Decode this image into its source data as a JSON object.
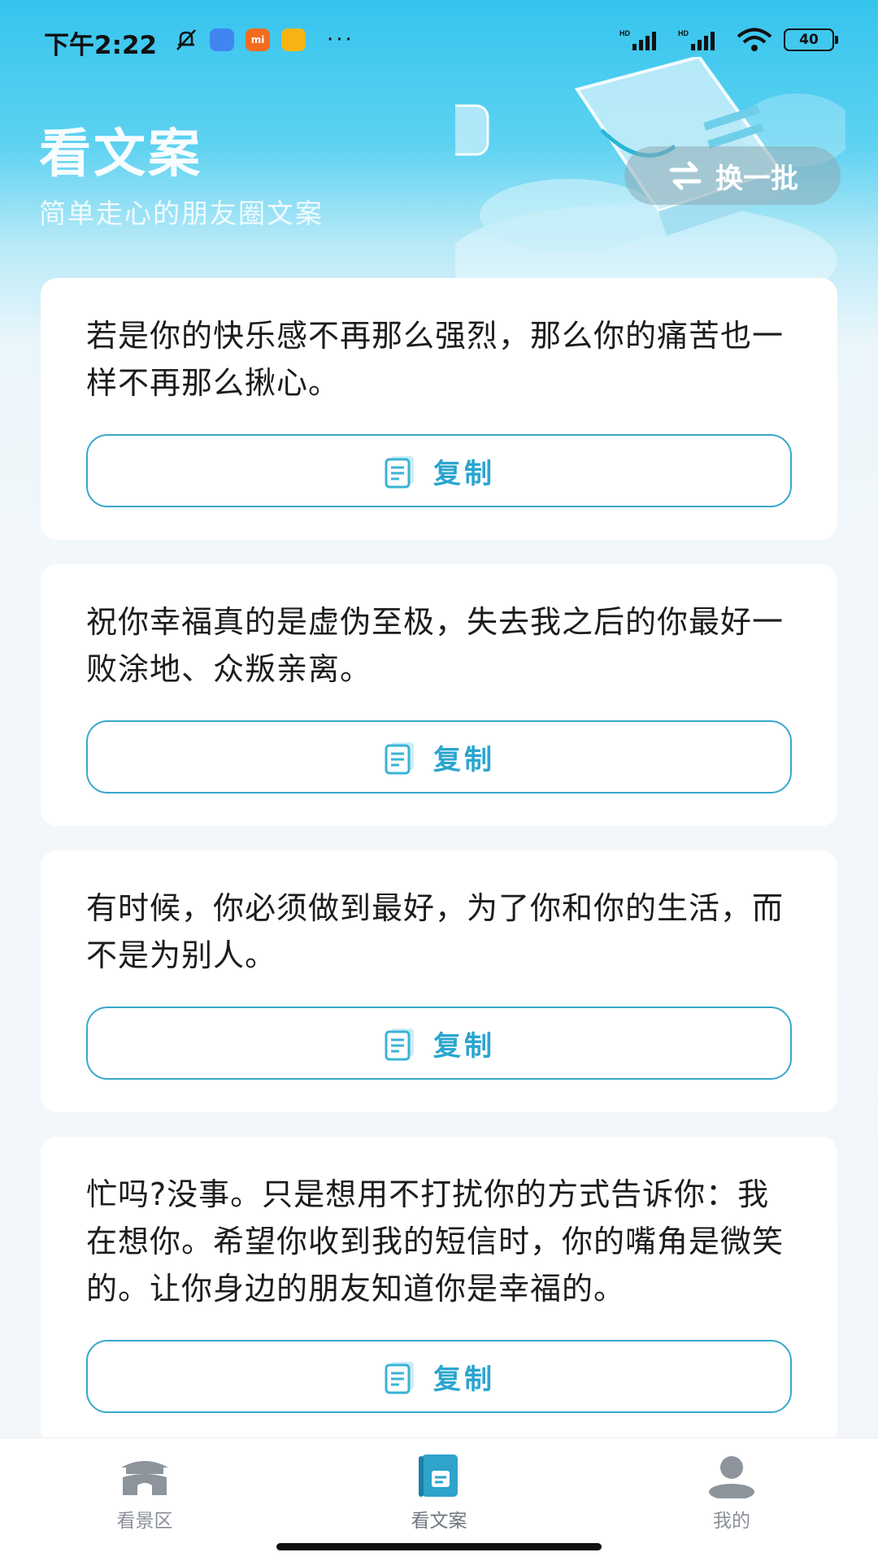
{
  "status_bar": {
    "time": "下午2:22",
    "badge_mi": "mi",
    "more": "···",
    "battery": "40"
  },
  "header": {
    "title": "看文案",
    "subtitle": "简单走心的朋友圈文案",
    "refresh_label": "换一批"
  },
  "cards": [
    {
      "text": "若是你的快乐感不再那么强烈，那么你的痛苦也一样不再那么揪心。",
      "copy_label": "复制"
    },
    {
      "text": "祝你幸福真的是虚伪至极，失去我之后的你最好一败涂地、众叛亲离。",
      "copy_label": "复制"
    },
    {
      "text": "有时候，你必须做到最好，为了你和你的生活，而不是为别人。",
      "copy_label": "复制"
    },
    {
      "text": "忙吗?没事。只是想用不打扰你的方式告诉你：我在想你。希望你收到我的短信时，你的嘴角是微笑的。让你身边的朋友知道你是幸福的。",
      "copy_label": "复制"
    }
  ],
  "bottom_nav": {
    "items": [
      {
        "label": "看景区",
        "icon": "pavilion-icon"
      },
      {
        "label": "看文案",
        "icon": "document-icon",
        "active": true
      },
      {
        "label": "我的",
        "icon": "user-icon"
      }
    ]
  },
  "colors": {
    "accent": "#2aa5cf",
    "header_top": "#35c4ee",
    "copy_border": "#36a8c9"
  }
}
